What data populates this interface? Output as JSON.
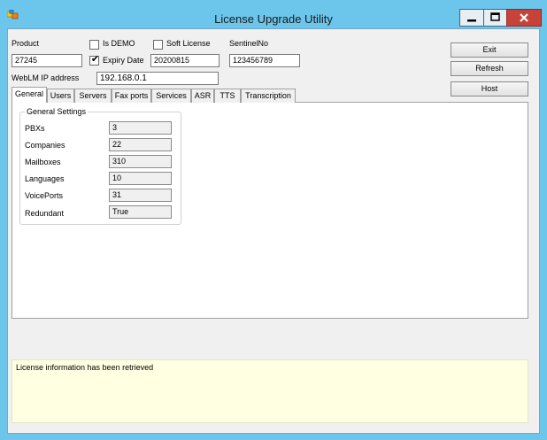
{
  "window": {
    "title": "License Upgrade Utility"
  },
  "header": {
    "product_label": "Product",
    "product_value": "27245",
    "is_demo_label": "Is DEMO",
    "is_demo_checked": false,
    "soft_license_label": "Soft License",
    "soft_license_checked": false,
    "expiry_label": "Expiry Date",
    "expiry_checked": true,
    "expiry_value": "20200815",
    "sentinel_label": "SentinelNo",
    "sentinel_value": "123456789",
    "weblm_label": "WebLM IP address",
    "weblm_value": "192.168.0.1"
  },
  "buttons": {
    "exit": "Exit",
    "refresh": "Refresh",
    "host": "Host"
  },
  "tabs": [
    "General",
    "Users",
    "Servers",
    "Fax ports",
    "Services",
    "ASR",
    "TTS",
    "Transcription"
  ],
  "active_tab": "General",
  "general_settings": {
    "title": "General Settings",
    "rows": [
      {
        "label": "PBXs",
        "value": "3"
      },
      {
        "label": "Companies",
        "value": "22"
      },
      {
        "label": "Mailboxes",
        "value": "310"
      },
      {
        "label": "Languages",
        "value": "10"
      },
      {
        "label": "VoicePorts",
        "value": "31"
      },
      {
        "label": "Redundant",
        "value": "True"
      }
    ]
  },
  "status": {
    "message": "License information has been retrieved"
  },
  "colors": {
    "frame": "#6cc5ea",
    "close_button": "#c7433a",
    "status_background": "#ffffe1"
  }
}
